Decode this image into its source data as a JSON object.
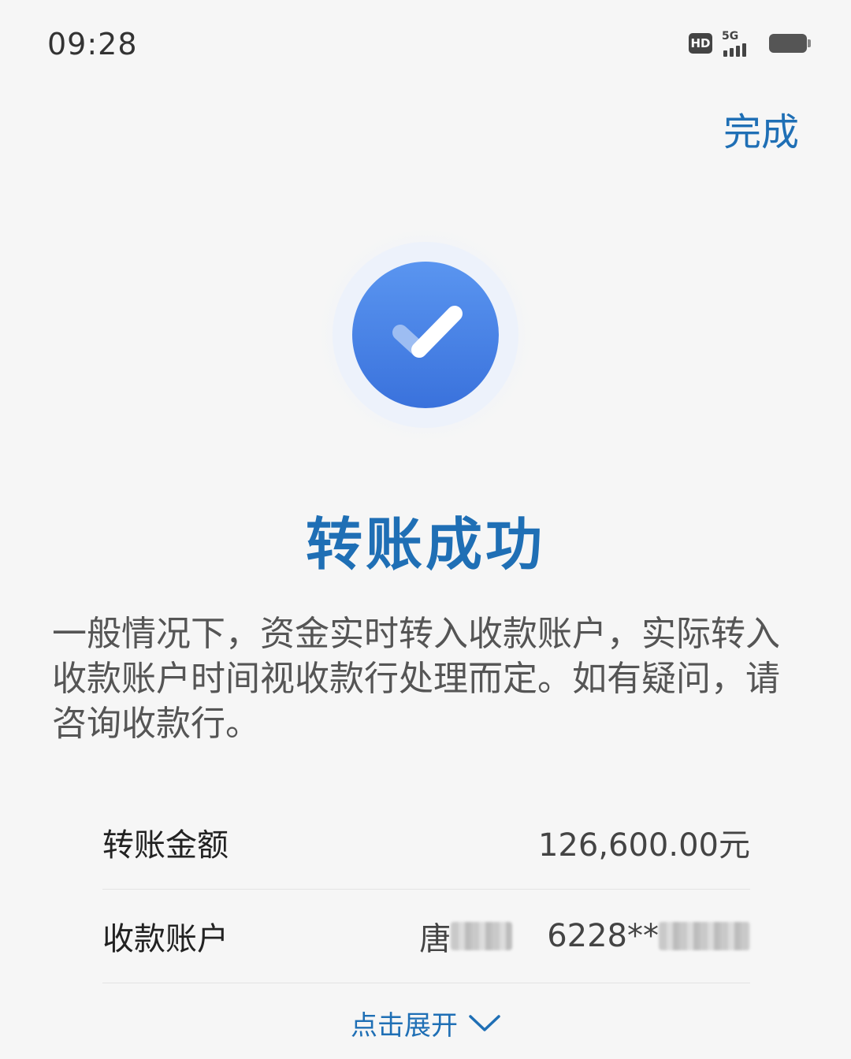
{
  "status_bar": {
    "time": "09:28",
    "hd": "HD",
    "network": "5G",
    "icons": [
      "hd-icon",
      "signal-5g-icon",
      "battery-icon"
    ]
  },
  "header": {
    "done_label": "完成"
  },
  "result": {
    "icon": "check-circle-icon",
    "title": "转账成功",
    "notice": "一般情况下，资金实时转入收款账户，实际转入收款账户时间视收款行处理而定。如有疑问，请咨询收款行。"
  },
  "details": {
    "amount_label": "转账金额",
    "amount_value": "126,600.00元",
    "account_label": "收款账户",
    "account_name_visible": "唐",
    "account_number_visible": "6228**"
  },
  "expand": {
    "label": "点击展开",
    "icon": "chevron-down-icon"
  },
  "colors": {
    "accent": "#1f6fb5",
    "check_circle": "#3d7fe6",
    "background": "#f6f6f6"
  }
}
